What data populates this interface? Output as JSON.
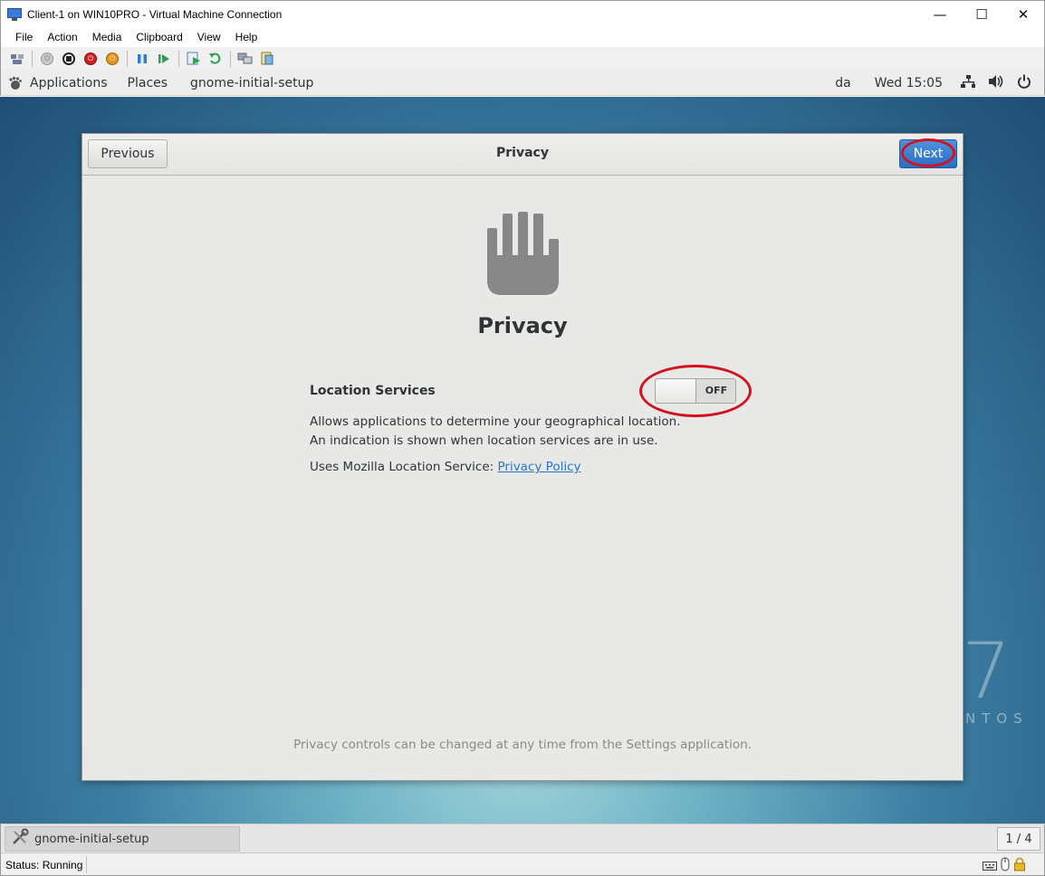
{
  "window": {
    "title": "Client-1 on WIN10PRO - Virtual Machine Connection",
    "minimize": "—",
    "maximize": "☐",
    "close": "✕"
  },
  "menu": [
    "File",
    "Action",
    "Media",
    "Clipboard",
    "View",
    "Help"
  ],
  "gnome_bar": {
    "applications": "Applications",
    "places": "Places",
    "app_name": "gnome-initial-setup",
    "keyboard_layout": "da",
    "clock": "Wed 15:05"
  },
  "dialog": {
    "previous_label": "Previous",
    "header_title": "Privacy",
    "next_label": "Next",
    "heading": "Privacy",
    "location_label": "Location Services",
    "toggle_state": "OFF",
    "toggle_on": false,
    "description": "Allows applications to determine your geographical location. An indication is shown when location services are in use.",
    "mozilla_text": "Uses Mozilla Location Service: ",
    "privacy_link": "Privacy Policy",
    "footer": "Privacy controls can be changed at any time from the Settings application."
  },
  "desktop": {
    "brand_number": "7",
    "brand_text": "NTOS"
  },
  "taskbar": {
    "task_label": "gnome-initial-setup",
    "workspace": "1 / 4"
  },
  "status": {
    "text": "Status: Running"
  },
  "colors": {
    "accent": "#2a6fc5",
    "annotation": "#d0141f",
    "link": "#2a76c6"
  }
}
